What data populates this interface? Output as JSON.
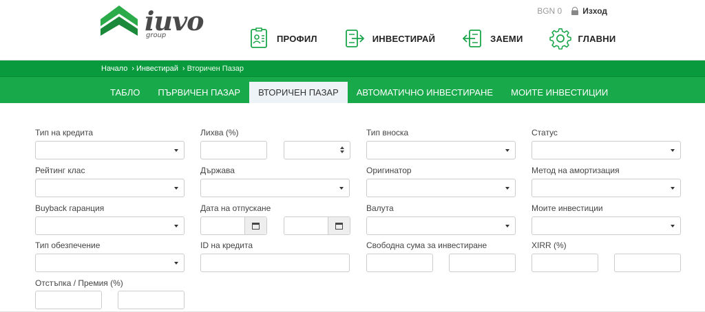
{
  "header": {
    "logo_text": "iuvo",
    "logo_sub": "group",
    "balance": "BGN 0",
    "logout_label": "Изход"
  },
  "main_nav": [
    {
      "label": "ПРОФИЛ",
      "icon": "profile-icon"
    },
    {
      "label": "ИНВЕСТИРАЙ",
      "icon": "invest-icon"
    },
    {
      "label": "ЗАЕМИ",
      "icon": "loans-icon"
    },
    {
      "label": "ГЛАВНИ",
      "icon": "gear-icon"
    }
  ],
  "breadcrumb": [
    "Начало",
    "Инвестирай",
    "Вторичен Пазар"
  ],
  "tabs": [
    {
      "label": "ТАБЛО",
      "active": false
    },
    {
      "label": "ПЪРВИЧЕН ПАЗАР",
      "active": false
    },
    {
      "label": "ВТОРИЧЕН ПАЗАР",
      "active": true
    },
    {
      "label": "АВТОМАТИЧНО ИНВЕСТИРАНЕ",
      "active": false
    },
    {
      "label": "МОИТЕ ИНВЕСТИЦИИ",
      "active": false
    }
  ],
  "filters": {
    "loan_type": "Тип на кредита",
    "interest": "Лихва (%)",
    "installment_type": "Тип вноска",
    "status": "Статус",
    "rating_class": "Рейтинг клас",
    "country": "Държава",
    "originator": "Оригинатор",
    "amortization_method": "Метод на амортизация",
    "buyback_guarantee": "Buyback гаранция",
    "issue_date": "Дата на отпускане",
    "currency": "Валута",
    "my_investments": "Моите инвестиции",
    "collateral_type": "Тип обезпечение",
    "loan_id": "ID на кредита",
    "free_amount": "Свободна сума за инвестиране",
    "xirr": "XIRR (%)",
    "discount_premium": "Отстъпка / Премия (%)"
  },
  "colors": {
    "brand_green": "#17a94a",
    "breadcrumb_green": "#0a9a3e",
    "active_tab_bg": "#eef3f7"
  }
}
